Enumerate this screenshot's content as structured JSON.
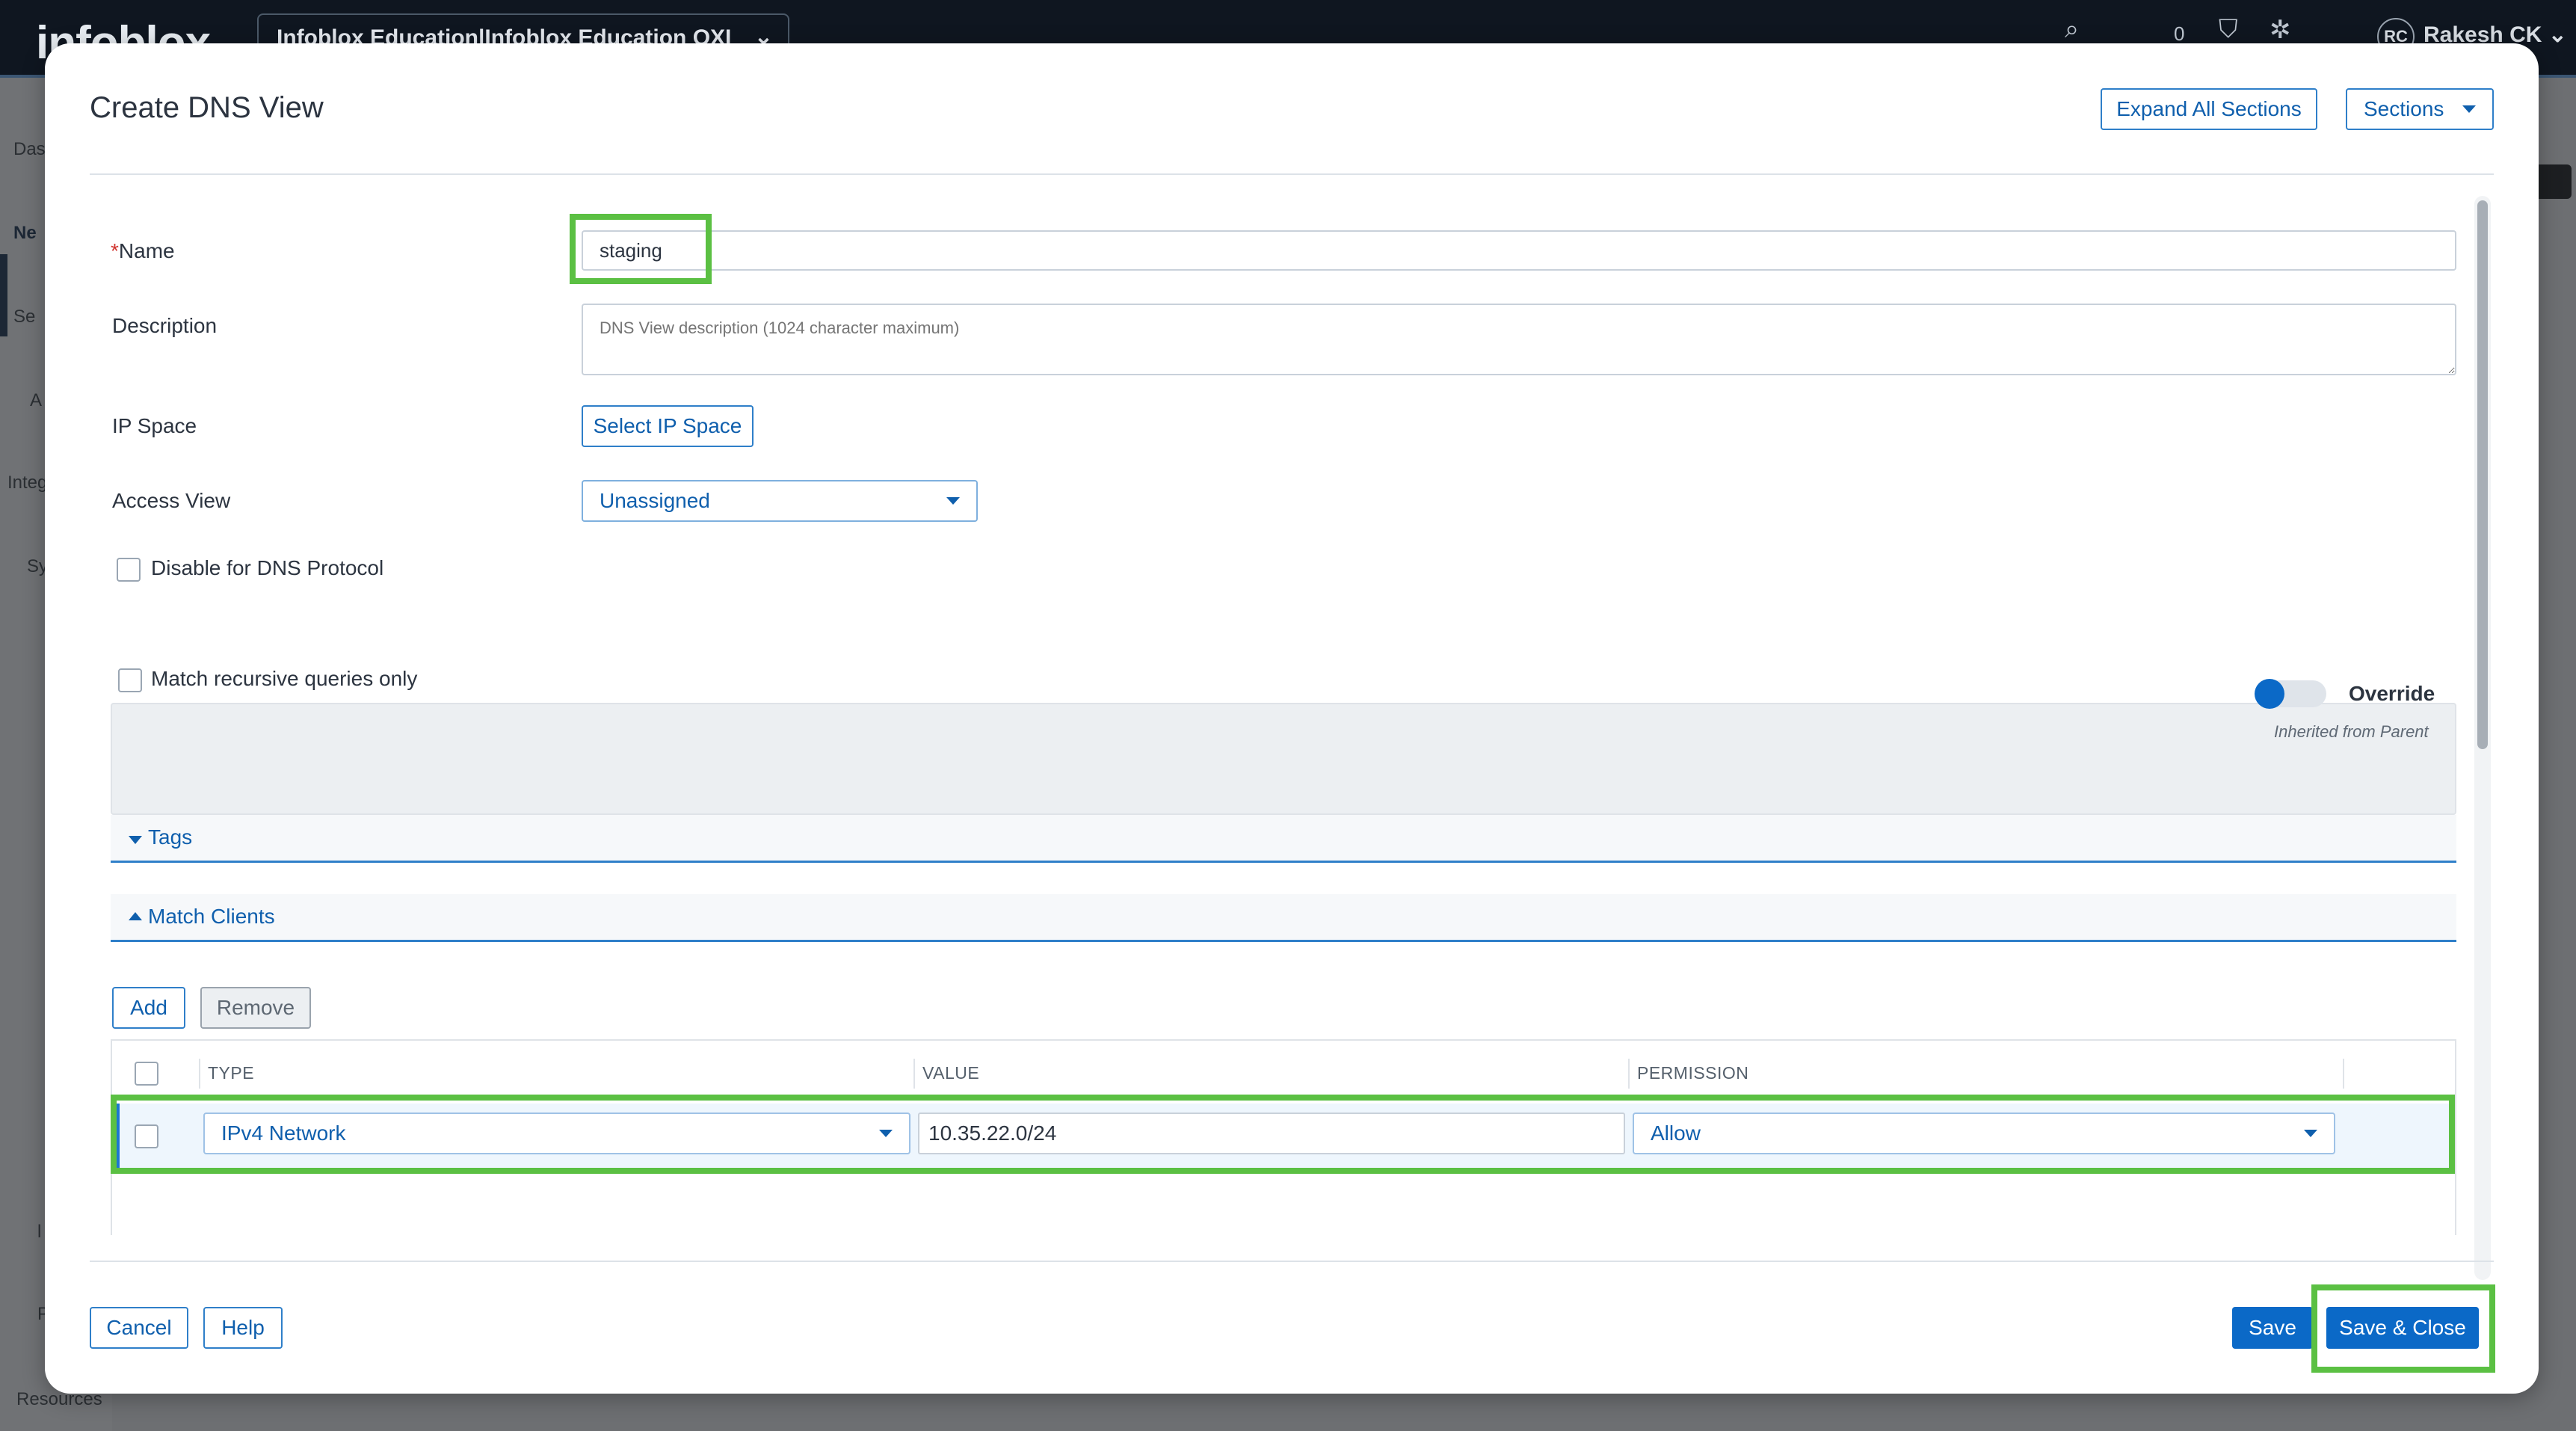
{
  "background": {
    "logo": "infoblox",
    "tenant": "Infoblox Education|Infoblox Education OXI",
    "notification_count": "0",
    "user_initials": "RC",
    "user_name": "Rakesh CK",
    "nav_fragments": [
      "Das",
      "Ne",
      "Se",
      "A",
      "Integ",
      "Sy",
      "l",
      "P",
      "Resources"
    ]
  },
  "modal": {
    "title": "Create DNS View",
    "expand_all_label": "Expand All Sections",
    "sections_label": "Sections"
  },
  "form": {
    "name_label": "Name",
    "name_required_mark": "*",
    "name_value": "staging",
    "description_label": "Description",
    "description_placeholder": "DNS View description (1024 character maximum)",
    "ip_space_label": "IP Space",
    "ip_space_button": "Select IP Space",
    "access_view_label": "Access View",
    "access_view_value": "Unassigned",
    "disable_dns_label": "Disable for DNS Protocol",
    "match_recursive_label": "Match recursive queries only",
    "override_label": "Override",
    "inherited_label": "Inherited from Parent"
  },
  "sections": {
    "tags_label": "Tags",
    "match_clients_label": "Match Clients"
  },
  "match_clients": {
    "add_label": "Add",
    "remove_label": "Remove",
    "columns": [
      "TYPE",
      "VALUE",
      "PERMISSION"
    ],
    "rows": [
      {
        "type": "IPv4 Network",
        "value": "10.35.22.0/24",
        "permission": "Allow"
      }
    ]
  },
  "footer": {
    "cancel_label": "Cancel",
    "help_label": "Help",
    "save_label": "Save",
    "save_close_label": "Save & Close"
  },
  "colors": {
    "accent": "#0b69c7",
    "highlight": "#5bc043",
    "required": "#d1342f"
  }
}
